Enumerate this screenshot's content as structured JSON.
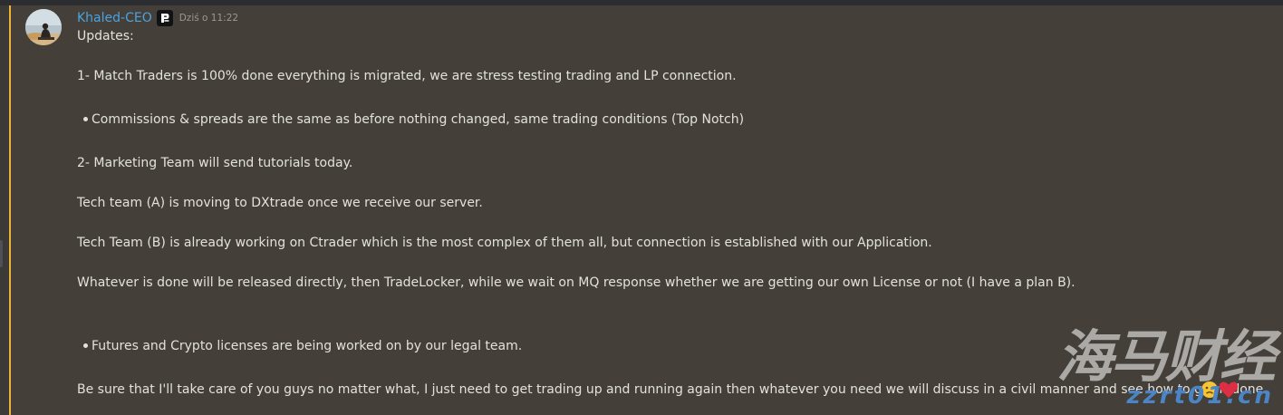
{
  "message": {
    "author": "Khaled-CEO",
    "timestamp": "Dziś o 11:22",
    "accent_color": "#f0b232",
    "username_color": "#4aa3e0",
    "lines": {
      "l1": "Updates:",
      "l2": "1- Match Traders is 100% done everything is migrated, we are stress testing trading and LP connection.",
      "l3": "Commissions & spreads are the same as before nothing changed, same trading conditions (Top Notch)",
      "l4": "2- Marketing Team will send tutorials today.",
      "l5": "Tech team (A) is moving to DXtrade once we receive our server.",
      "l6": "Tech Team (B) is already working on Ctrader which is the most complex of them all, but connection is established with our Application.",
      "l7": "Whatever is done will be released directly, then TradeLocker, while we wait on MQ response whether we are getting our own License or not (I have a plan B).",
      "l8": "Futures and Crypto licenses are being worked on by our legal team.",
      "l9": "Be sure that I'll take care of you guys no matter what, I just need to get trading up and running again then whatever you need we will discuss in a civil manner and see how to get it done"
    },
    "emojis": [
      "slightly-frowning-face",
      "red-heart"
    ]
  },
  "watermark": {
    "brand": "海马财经",
    "url": "zzrt01.cn"
  }
}
